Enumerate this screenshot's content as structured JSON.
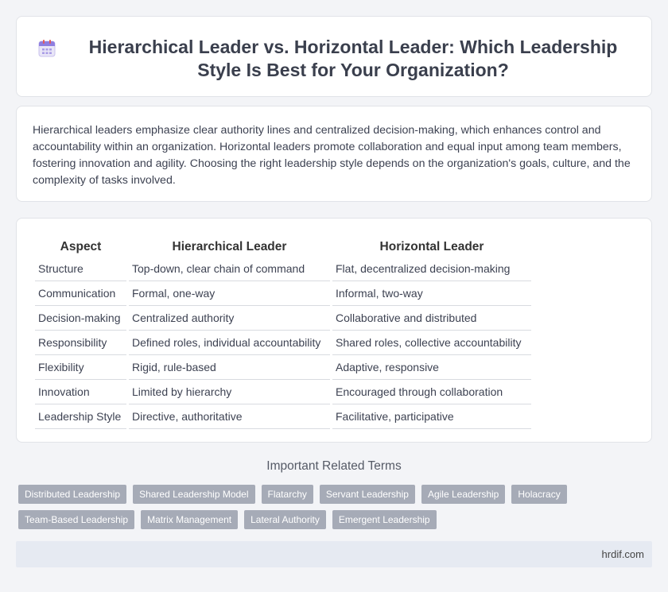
{
  "header": {
    "title": "Hierarchical Leader vs. Horizontal Leader: Which Leadership Style Is Best for Your Organization?",
    "icon": "calendar-icon"
  },
  "intro": {
    "text": "Hierarchical leaders emphasize clear authority lines and centralized decision-making, which enhances control and accountability within an organization. Horizontal leaders promote collaboration and equal input among team members, fostering innovation and agility. Choosing the right leadership style depends on the organization's goals, culture, and the complexity of tasks involved."
  },
  "comparison": {
    "headers": [
      "Aspect",
      "Hierarchical Leader",
      "Horizontal Leader"
    ],
    "rows": [
      [
        "Structure",
        "Top-down, clear chain of command",
        "Flat, decentralized decision-making"
      ],
      [
        "Communication",
        "Formal, one-way",
        "Informal, two-way"
      ],
      [
        "Decision-making",
        "Centralized authority",
        "Collaborative and distributed"
      ],
      [
        "Responsibility",
        "Defined roles, individual accountability",
        "Shared roles, collective accountability"
      ],
      [
        "Flexibility",
        "Rigid, rule-based",
        "Adaptive, responsive"
      ],
      [
        "Innovation",
        "Limited by hierarchy",
        "Encouraged through collaboration"
      ],
      [
        "Leadership Style",
        "Directive, authoritative",
        "Facilitative, participative"
      ]
    ]
  },
  "related": {
    "title": "Important Related Terms",
    "tags": [
      "Distributed Leadership",
      "Shared Leadership Model",
      "Flatarchy",
      "Servant Leadership",
      "Agile Leadership",
      "Holacracy",
      "Team-Based Leadership",
      "Matrix Management",
      "Lateral Authority",
      "Emergent Leadership"
    ]
  },
  "footer": {
    "site": "hrdif.com"
  },
  "colors": {
    "tag_bg": "#a6abb7",
    "footer_bg": "#e6eaf2",
    "page_bg": "#f3f4f7"
  }
}
